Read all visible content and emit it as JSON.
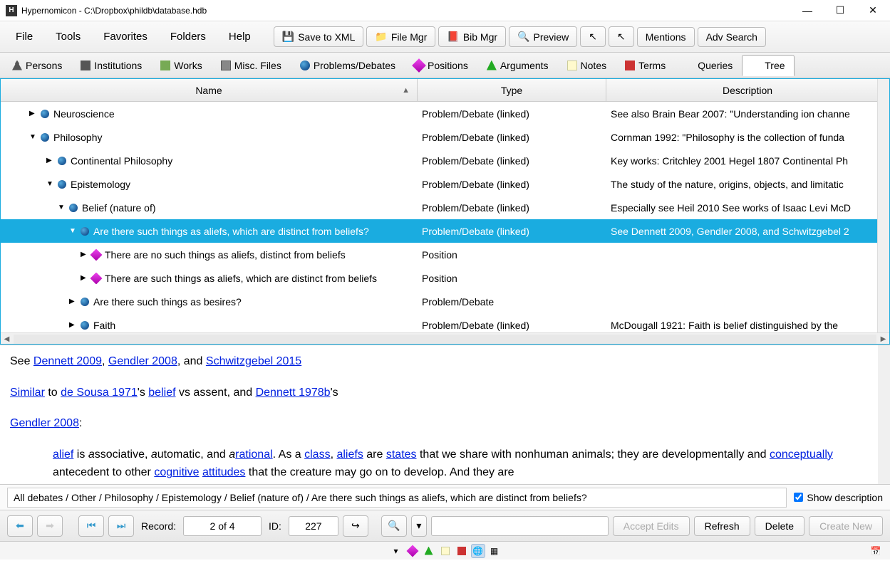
{
  "window": {
    "title": "Hypernomicon - C:\\Dropbox\\phildb\\database.hdb"
  },
  "menus": [
    "File",
    "Tools",
    "Favorites",
    "Folders",
    "Help"
  ],
  "toolbar": {
    "saveXml": "Save to XML",
    "fileMgr": "File Mgr",
    "bibMgr": "Bib Mgr",
    "preview": "Preview",
    "mentions": "Mentions",
    "advSearch": "Adv Search"
  },
  "tabs": [
    {
      "name": "persons",
      "label": "Persons",
      "icon": "person"
    },
    {
      "name": "institutions",
      "label": "Institutions",
      "icon": "building"
    },
    {
      "name": "works",
      "label": "Works",
      "icon": "book"
    },
    {
      "name": "misc-files",
      "label": "Misc. Files",
      "icon": "file"
    },
    {
      "name": "problems-debates",
      "label": "Problems/Debates",
      "icon": "blue"
    },
    {
      "name": "positions",
      "label": "Positions",
      "icon": "magenta"
    },
    {
      "name": "arguments",
      "label": "Arguments",
      "icon": "green"
    },
    {
      "name": "notes",
      "label": "Notes",
      "icon": "note"
    },
    {
      "name": "terms",
      "label": "Terms",
      "icon": "term"
    },
    {
      "name": "queries",
      "label": "Queries",
      "icon": "query"
    },
    {
      "name": "tree",
      "label": "Tree",
      "icon": "tree",
      "active": true
    }
  ],
  "tree": {
    "headers": {
      "name": "Name",
      "type": "Type",
      "desc": "Description"
    },
    "rows": [
      {
        "indent": 40,
        "exp": "▶",
        "icon": "blue",
        "name": "Neuroscience",
        "type": "Problem/Debate (linked)",
        "desc": "See also Brain Bear 2007: \"Understanding ion channe"
      },
      {
        "indent": 40,
        "exp": "▼",
        "icon": "blue",
        "name": "Philosophy",
        "type": "Problem/Debate (linked)",
        "desc": "Cornman 1992: \"Philosophy is the collection of funda"
      },
      {
        "indent": 64,
        "exp": "▶",
        "icon": "blue",
        "name": "Continental Philosophy",
        "type": "Problem/Debate (linked)",
        "desc": "Key works: Critchley 2001 Hegel 1807 Continental Ph"
      },
      {
        "indent": 64,
        "exp": "▼",
        "icon": "blue",
        "name": "Epistemology",
        "type": "Problem/Debate (linked)",
        "desc": "The study of the nature, origins, objects, and limitatic"
      },
      {
        "indent": 80,
        "exp": "▼",
        "icon": "blue",
        "name": "Belief (nature of)",
        "type": "Problem/Debate (linked)",
        "desc": "Especially see Heil 2010 See works of Isaac Levi McD"
      },
      {
        "indent": 96,
        "exp": "▼",
        "icon": "blue",
        "name": "Are there such things as aliefs, which are distinct from beliefs?",
        "type": "Problem/Debate (linked)",
        "desc": "See Dennett 2009, Gendler 2008, and Schwitzgebel 2",
        "selected": true
      },
      {
        "indent": 112,
        "exp": "▶",
        "icon": "magenta",
        "name": "There are no such things as aliefs, distinct from beliefs",
        "type": "Position",
        "desc": ""
      },
      {
        "indent": 112,
        "exp": "▶",
        "icon": "magenta",
        "name": "There are such things as aliefs, which are distinct from beliefs",
        "type": "Position",
        "desc": ""
      },
      {
        "indent": 96,
        "exp": "▶",
        "icon": "blue",
        "name": "Are there such things as besires?",
        "type": "Problem/Debate",
        "desc": ""
      },
      {
        "indent": 96,
        "exp": "▶",
        "icon": "blue",
        "name": "Faith",
        "type": "Problem/Debate (linked)",
        "desc": "McDougall 1921: Faith is belief distinguished by the"
      }
    ]
  },
  "description": {
    "see": "See ",
    "link1": "Dennett 2009",
    "comma1": ", ",
    "link2": "Gendler 2008",
    "and1": ", and ",
    "link3": "Schwitzgebel 2015",
    "similarLink": "Similar",
    "to": " to ",
    "link4": "de Sousa 1971",
    "s1": "'s ",
    "link5": "belief",
    "vs": " vs assent, and ",
    "link6": "Dennett 1978b",
    "s2": "'s",
    "link7": "Gendler 2008",
    "colon": ":",
    "aliefLink": "alief",
    "body1": " is ",
    "a1": "a",
    "body2": "ssociative, ",
    "a2": "a",
    "body3": "utomatic, and ",
    "a3": "a",
    "rationalLink": "rational",
    "body4": ". As a ",
    "classLink": "class",
    "body5": ", ",
    "aliefsLink": "aliefs",
    "body6": " are ",
    "statesLink": "states",
    "body7": " that we share with nonhuman animals; they are developmentally and ",
    "conceptLink": "conceptually",
    "body8": " antecedent to other ",
    "cogLink": "cognitive",
    "sp": " ",
    "attLink": "attitudes",
    "body9": " that the creature may go on to develop. And they are"
  },
  "breadcrumb": "All debates / Other / Philosophy / Epistemology / Belief (nature of) / Are there such things as aliefs, which are distinct from beliefs?",
  "showDesc": "Show description",
  "nav": {
    "recordLabel": "Record:",
    "recordVal": "2 of 4",
    "idLabel": "ID:",
    "idVal": "227",
    "acceptEdits": "Accept Edits",
    "refresh": "Refresh",
    "delete": "Delete",
    "createNew": "Create New"
  }
}
